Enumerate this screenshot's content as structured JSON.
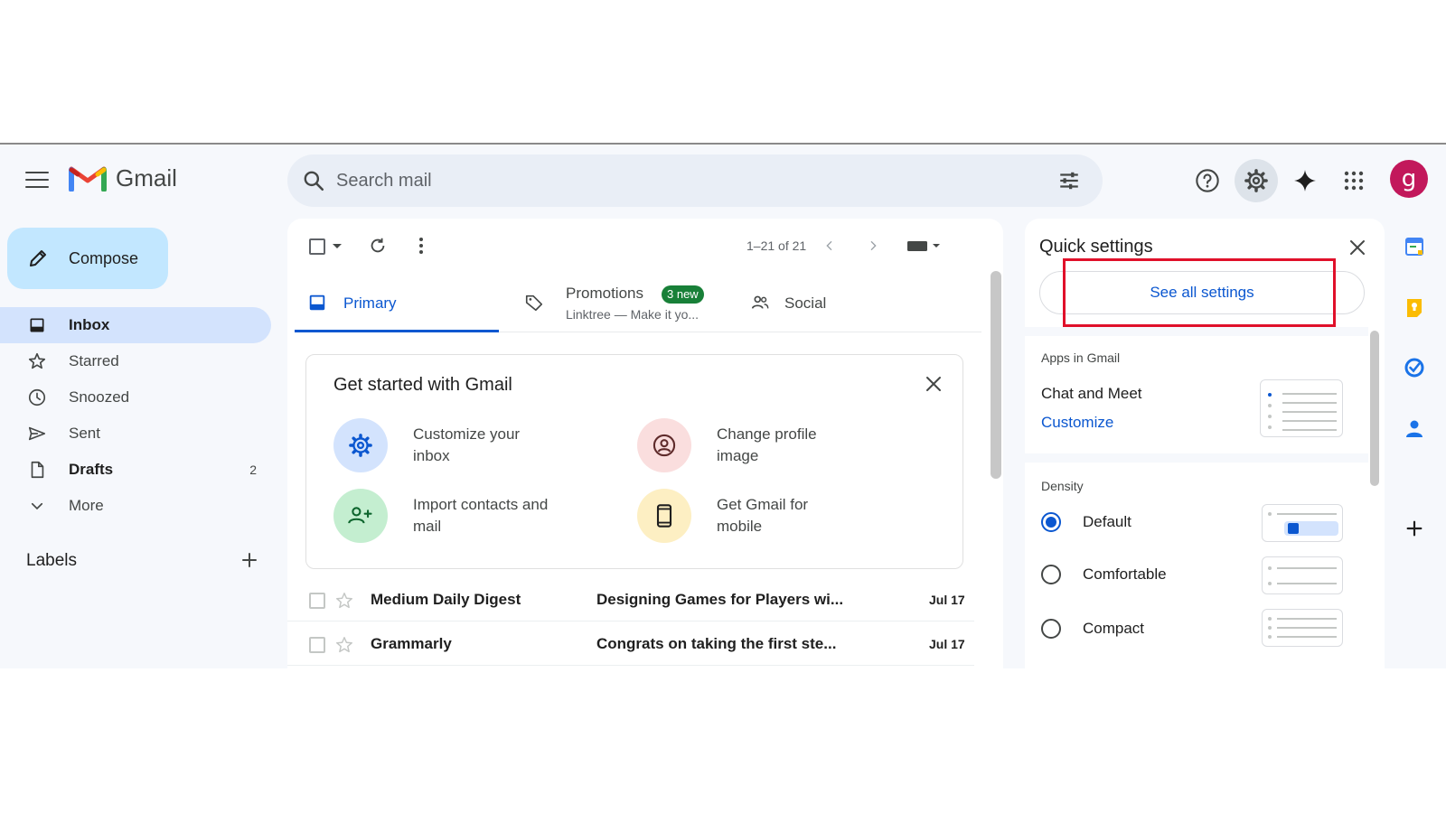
{
  "app": {
    "brand": "Gmail"
  },
  "search": {
    "placeholder": "Search mail"
  },
  "sidebar": {
    "compose_label": "Compose",
    "items": [
      {
        "label": "Inbox",
        "icon": "inbox-icon",
        "active": true
      },
      {
        "label": "Starred",
        "icon": "star-icon"
      },
      {
        "label": "Snoozed",
        "icon": "clock-icon"
      },
      {
        "label": "Sent",
        "icon": "send-icon"
      },
      {
        "label": "Drafts",
        "icon": "draft-icon",
        "count": "2"
      },
      {
        "label": "More",
        "icon": "chevron-down-icon"
      }
    ],
    "labels_heading": "Labels"
  },
  "toolbar": {
    "pager": "1–21 of 21"
  },
  "tabs": {
    "primary": "Primary",
    "promotions": "Promotions",
    "promotions_badge": "3 new",
    "promotions_sub": "Linktree — Make it yo...",
    "social": "Social"
  },
  "get_started": {
    "title": "Get started with Gmail",
    "items": [
      {
        "label": "Customize your inbox",
        "icon": "gear-icon",
        "color": "#d3e3fd"
      },
      {
        "label": "Change profile image",
        "icon": "account-icon",
        "color": "#fadede"
      },
      {
        "label": "Import contacts and mail",
        "icon": "add-person-icon",
        "color": "#c4eed0"
      },
      {
        "label": "Get Gmail for mobile",
        "icon": "phone-icon",
        "color": "#fdefc3"
      }
    ]
  },
  "emails": [
    {
      "sender": "Medium Daily Digest",
      "subject": "Designing Games for Players wi...",
      "date": "Jul 17"
    },
    {
      "sender": "Grammarly",
      "subject": "Congrats on taking the first ste...",
      "date": "Jul 17"
    }
  ],
  "quick_settings": {
    "title": "Quick settings",
    "see_all": "See all settings",
    "apps_heading": "Apps in Gmail",
    "chat_meet": "Chat and Meet",
    "customize": "Customize",
    "density_heading": "Density",
    "density_options": [
      "Default",
      "Comfortable",
      "Compact"
    ],
    "density_selected": "Default"
  },
  "colors": {
    "accent": "#0b57d0",
    "compose_bg": "#c2e7ff",
    "active_nav": "#d3e3fd",
    "avatar": "#c2185b",
    "highlight_box": "#e0102a",
    "badge": "#188038"
  },
  "user": {
    "avatar_letter": "g"
  }
}
